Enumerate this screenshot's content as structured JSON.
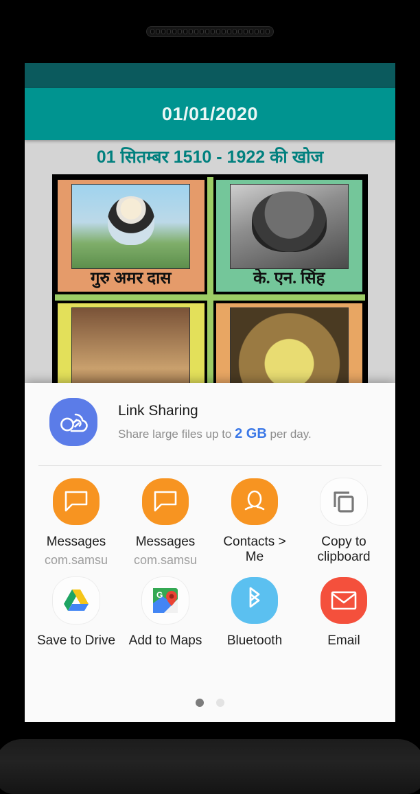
{
  "app": {
    "toolbar_date": "01/01/2020",
    "subtitle": "01 सितम्बर 1510 - 1922 की खोज"
  },
  "colors": {
    "statusbar": "#0b5a5d",
    "toolbar": "#009490",
    "subtitle_text": "#00807e",
    "page_bg": "#d4d4d4",
    "sheet_bg": "#fafafa",
    "accent_blue": "#3b78e7"
  },
  "collage": {
    "cells": [
      {
        "label": "गुरु अमर दास"
      },
      {
        "label": "के. एन. सिंह"
      },
      {
        "label": ""
      },
      {
        "label": ""
      }
    ]
  },
  "share_sheet": {
    "link_sharing": {
      "icon": "cloud-link-icon",
      "title": "Link Sharing",
      "sub_prefix": "Share large files up to ",
      "sub_highlight": "2 GB",
      "sub_suffix": " per day."
    },
    "targets": [
      {
        "name": "Messages",
        "sub": "com.samsu",
        "icon": "message-bubble-icon",
        "style": "orange"
      },
      {
        "name": "Messages",
        "sub": "com.samsu",
        "icon": "message-bubble-icon",
        "style": "orange"
      },
      {
        "name": "Contacts > Me",
        "sub": "",
        "icon": "contact-person-icon",
        "style": "orange"
      },
      {
        "name": "Copy to clipboard",
        "sub": "",
        "icon": "copy-clipboard-icon",
        "style": "whiteic"
      },
      {
        "name": "Save to Drive",
        "sub": "",
        "icon": "google-drive-icon",
        "style": "whiteic"
      },
      {
        "name": "Add to Maps",
        "sub": "",
        "icon": "google-maps-icon",
        "style": "whiteic"
      },
      {
        "name": "Bluetooth",
        "sub": "",
        "icon": "bluetooth-icon",
        "style": "blue"
      },
      {
        "name": "Email",
        "sub": "",
        "icon": "envelope-icon",
        "style": "red"
      }
    ],
    "pagination": {
      "pages": 2,
      "active": 1
    }
  }
}
